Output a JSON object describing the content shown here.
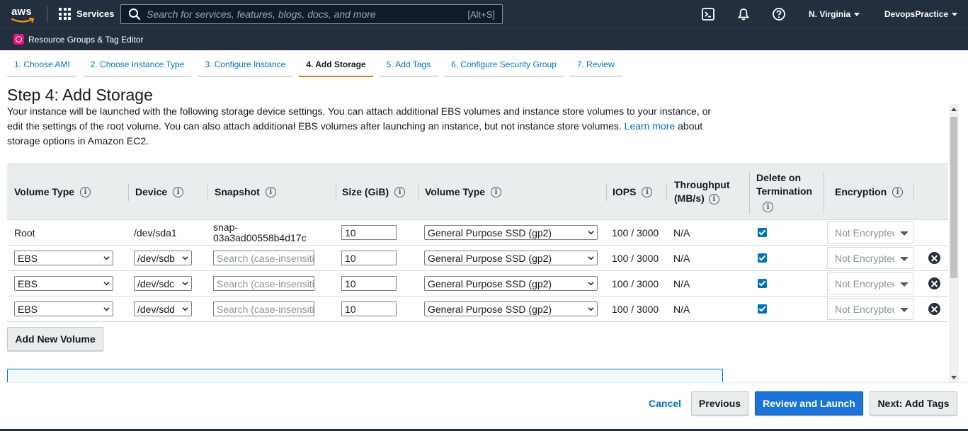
{
  "topnav": {
    "logo_text": "aws",
    "services_label": "Services",
    "search_placeholder": "Search for services, features, blogs, docs, and more",
    "search_shortcut": "[Alt+S]",
    "region_label": "N. Virginia",
    "account_label": "DevopsPractice"
  },
  "subnav": {
    "resource_groups_label": "Resource Groups & Tag Editor"
  },
  "wizard_tabs": [
    {
      "label": "1. Choose AMI"
    },
    {
      "label": "2. Choose Instance Type"
    },
    {
      "label": "3. Configure Instance"
    },
    {
      "label": "4. Add Storage"
    },
    {
      "label": "5. Add Tags"
    },
    {
      "label": "6. Configure Security Group"
    },
    {
      "label": "7. Review"
    }
  ],
  "page": {
    "title": "Step 4: Add Storage",
    "description_part1": "Your instance will be launched with the following storage device settings. You can attach additional EBS volumes and instance store volumes to your instance, or edit the settings of the root volume. You can also attach additional EBS volumes after launching an instance, but not instance store volumes. ",
    "learn_more_link": "Learn more",
    "description_part2": " about storage options in Amazon EC2."
  },
  "table": {
    "headers": {
      "volume_type": "Volume Type",
      "device": "Device",
      "snapshot": "Snapshot",
      "size": "Size (GiB)",
      "volume_type2": "Volume Type",
      "iops": "IOPS",
      "throughput_line1": "Throughput",
      "throughput_line2": "(MB/s)",
      "delete_line1": "Delete on",
      "delete_line2": "Termination",
      "encryption": "Encryption"
    },
    "info_glyph": "i",
    "rows": [
      {
        "volume_type": "Root",
        "device": "/dev/sda1",
        "snapshot_line1": "snap-",
        "snapshot_line2": "03a3ad00558b4d17c",
        "size": "10",
        "ebs_type": "General Purpose SSD (gp2)",
        "iops": "100 / 3000",
        "throughput": "N/A",
        "encryption": "Not Encrypted"
      },
      {
        "volume_type": "EBS",
        "device": "/dev/sdb",
        "snapshot_placeholder": "Search (case-insensitive)",
        "size": "10",
        "ebs_type": "General Purpose SSD (gp2)",
        "iops": "100 / 3000",
        "throughput": "N/A",
        "encryption": "Not Encrypted"
      },
      {
        "volume_type": "EBS",
        "device": "/dev/sdc",
        "snapshot_placeholder": "Search (case-insensitive)",
        "size": "10",
        "ebs_type": "General Purpose SSD (gp2)",
        "iops": "100 / 3000",
        "throughput": "N/A",
        "encryption": "Not Encrypted"
      },
      {
        "volume_type": "EBS",
        "device": "/dev/sdd",
        "snapshot_placeholder": "Search (case-insensitive)",
        "size": "10",
        "ebs_type": "General Purpose SSD (gp2)",
        "iops": "100 / 3000",
        "throughput": "N/A",
        "encryption": "Not Encrypted"
      }
    ]
  },
  "actions": {
    "add_volume": "Add New Volume",
    "cancel": "Cancel",
    "previous": "Previous",
    "review_launch": "Review and Launch",
    "next": "Next: Add Tags"
  },
  "colors": {
    "nav_bg": "#232f3e",
    "link": "#0073bb",
    "active_tab": "#ec7211",
    "primary_button": "#1a73d6"
  }
}
